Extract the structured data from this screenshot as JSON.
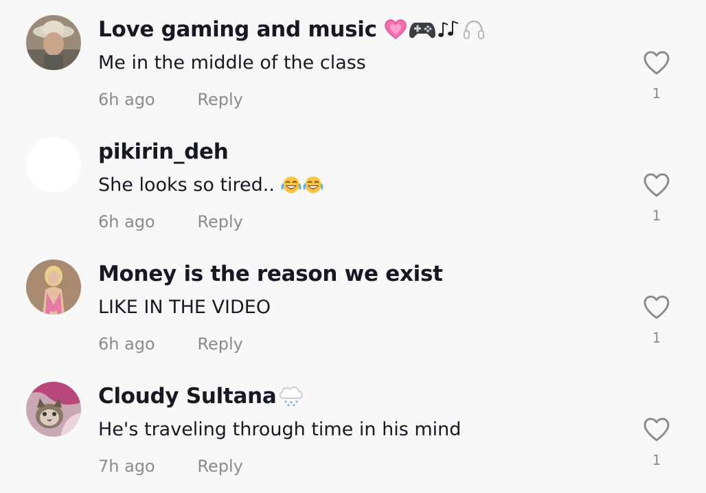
{
  "comments": [
    {
      "author": "Love gaming and music",
      "author_emojis": [
        "pink-heart",
        "game-controller",
        "musical-notes",
        "headphones"
      ],
      "text": "Me in the middle of the class",
      "text_emojis": [],
      "time": "6h ago",
      "reply_label": "Reply",
      "likes": "1",
      "avatar": "photo-person-hat"
    },
    {
      "author": "pikirin_deh",
      "author_emojis": [],
      "text": "She looks so tired..",
      "text_emojis": [
        "tears-of-joy",
        "tears-of-joy"
      ],
      "time": "6h ago",
      "reply_label": "Reply",
      "likes": "1",
      "avatar": "blank-white"
    },
    {
      "author": "Money is the reason we exist",
      "author_emojis": [],
      "text": "LIKE IN THE VIDEO",
      "text_emojis": [],
      "time": "6h ago",
      "reply_label": "Reply",
      "likes": "1",
      "avatar": "photo-blonde-woman"
    },
    {
      "author": "Cloudy Sultana",
      "author_emojis": [
        "cloud-with-snow"
      ],
      "text": "He's traveling through time in his mind",
      "text_emojis": [],
      "time": "7h ago",
      "reply_label": "Reply",
      "likes": "1",
      "avatar": "photo-cat"
    }
  ],
  "colors": {
    "background": "#f8f8f8",
    "text_primary": "#161823",
    "text_secondary": "#8a8b91",
    "like_icon": "#8a8b91"
  },
  "icons": {
    "like": "heart-outline-icon"
  }
}
